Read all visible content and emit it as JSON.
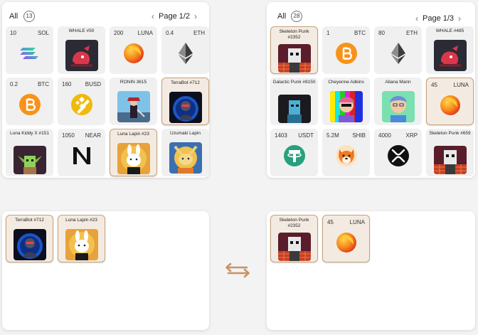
{
  "left_inventory": {
    "all_label": "All",
    "count": "13",
    "page": "Page 1/2",
    "items": [
      {
        "kind": "coin",
        "qty": "10",
        "sym": "SOL",
        "icon": "solana-icon"
      },
      {
        "kind": "nft",
        "name": "WHALE #50",
        "icon": "whale-nft-art"
      },
      {
        "kind": "coin",
        "qty": "200",
        "sym": "LUNA",
        "icon": "luna-icon"
      },
      {
        "kind": "coin",
        "qty": "0.4",
        "sym": "ETH",
        "icon": "ethereum-icon"
      },
      {
        "kind": "coin",
        "qty": "0.2",
        "sym": "BTC",
        "icon": "bitcoin-icon"
      },
      {
        "kind": "coin",
        "qty": "160",
        "sym": "BUSD",
        "icon": "busd-icon"
      },
      {
        "kind": "nft",
        "name": "RONIN 3615",
        "icon": "ronin-nft-art"
      },
      {
        "kind": "nft",
        "name": "TerraBot #712",
        "icon": "terrabot-nft-art",
        "selected": true
      },
      {
        "kind": "nft",
        "name": "Luna Kiddy X #151",
        "icon": "luna-kiddy-nft-art"
      },
      {
        "kind": "coin",
        "qty": "1050",
        "sym": "NEAR",
        "icon": "near-icon"
      },
      {
        "kind": "nft",
        "name": "Luna Lapin #23",
        "icon": "luna-lapin-nft-art",
        "selected": true
      },
      {
        "kind": "nft",
        "name": "Uzumaki Lapin",
        "icon": "uzumaki-lapin-nft-art"
      }
    ]
  },
  "right_inventory": {
    "all_label": "All",
    "count": "28",
    "page": "Page 1/3",
    "items": [
      {
        "kind": "nft",
        "name": "Skeleton Punk #2352",
        "icon": "skeleton-punk-nft-art",
        "selected": true
      },
      {
        "kind": "coin",
        "qty": "1",
        "sym": "BTC",
        "icon": "bitcoin-icon"
      },
      {
        "kind": "coin",
        "qty": "80",
        "sym": "ETH",
        "icon": "ethereum-icon"
      },
      {
        "kind": "nft",
        "name": "WHALE #485",
        "icon": "whale-nft-art"
      },
      {
        "kind": "nft",
        "name": "Galactic Punk #8150",
        "icon": "galactic-punk-nft-art"
      },
      {
        "kind": "nft",
        "name": "Cheyenne Adkins",
        "icon": "cheyenne-nft-art"
      },
      {
        "kind": "nft",
        "name": "Aliana Mann",
        "icon": "aliana-nft-art"
      },
      {
        "kind": "coin",
        "qty": "45",
        "sym": "LUNA",
        "icon": "luna-icon",
        "selected": true
      },
      {
        "kind": "coin",
        "qty": "1403",
        "sym": "USDT",
        "icon": "tether-icon"
      },
      {
        "kind": "coin",
        "qty": "5.2M",
        "sym": "SHIB",
        "icon": "shiba-icon"
      },
      {
        "kind": "coin",
        "qty": "4000",
        "sym": "XRP",
        "icon": "xrp-icon"
      },
      {
        "kind": "nft",
        "name": "Skeleton Punk #659",
        "icon": "skeleton-punk-nft-art"
      }
    ]
  },
  "left_offer": {
    "items": [
      {
        "kind": "nft",
        "name": "TerraBot #712",
        "icon": "terrabot-nft-art",
        "selected": true
      },
      {
        "kind": "nft",
        "name": "Luna Lapin #23",
        "icon": "luna-lapin-nft-art",
        "selected": true
      }
    ]
  },
  "right_offer": {
    "items": [
      {
        "kind": "nft",
        "name": "Skeleton Punk #2352",
        "icon": "skeleton-punk-nft-art",
        "selected": true
      },
      {
        "kind": "coin",
        "qty": "45",
        "sym": "LUNA",
        "icon": "luna-icon",
        "selected": true
      }
    ]
  },
  "swap_icon": "swap-arrows-icon",
  "colors": {
    "accent": "#c7a27e",
    "selected_bg": "#f3ebe1",
    "card_bg": "#f0f0f0",
    "swap": "#c79467"
  }
}
